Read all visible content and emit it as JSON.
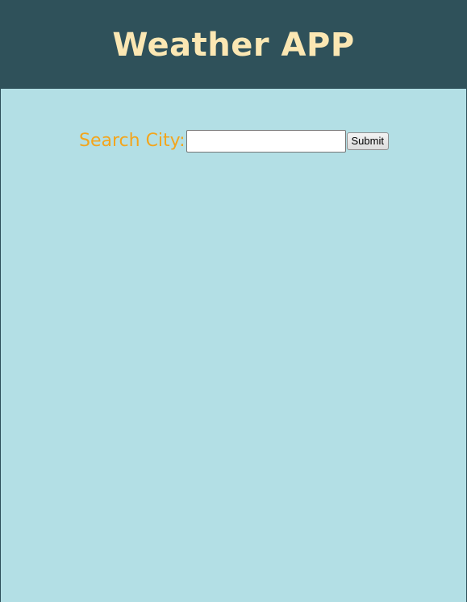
{
  "header": {
    "title": "Weather APP"
  },
  "search": {
    "label": "Search City:",
    "input_value": "",
    "input_placeholder": "",
    "submit_label": "Submit"
  },
  "colors": {
    "header_bg": "#2f515a",
    "title": "#fbe7b3",
    "page_bg": "#b3dfe5",
    "label": "#f3a51c"
  }
}
